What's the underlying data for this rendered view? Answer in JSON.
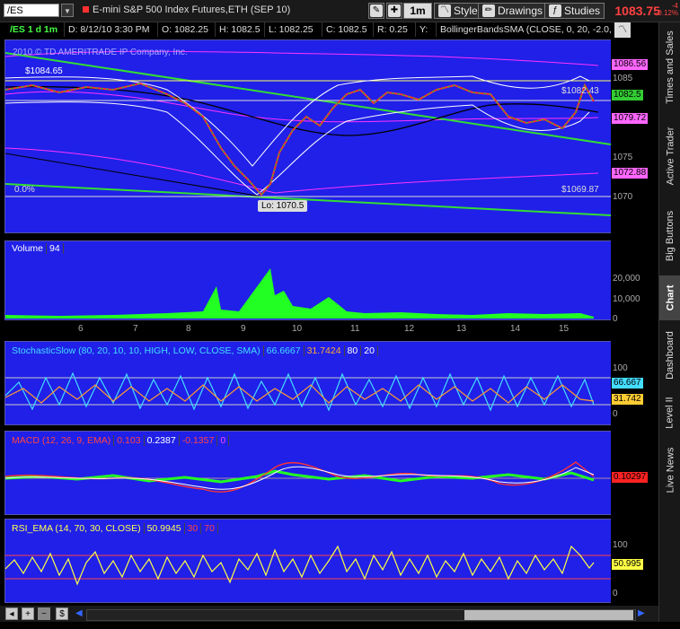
{
  "symbol": "/ES",
  "description": "E-mini S&P 500 Index Futures,ETH (SEP 10)",
  "toolbar": {
    "interval_label": "1m",
    "style_label": "Style",
    "drawings_label": "Drawings",
    "studies_label": "Studies",
    "last_price": "1083.75",
    "change_top": "-4",
    "change_bottom": "-0.12%"
  },
  "header": {
    "symbol_period": "/ES 1 d 1m",
    "date": "D: 8/12/10 3:30 PM",
    "open": "O: 1082.25",
    "high": "H: 1082.5",
    "low": "L: 1082.25",
    "close": "C: 1082.5",
    "range": "R: 0.25",
    "y": "Y:",
    "study": "BollingerBandsSMA (CLOSE, 0, 20, -2.0, ..."
  },
  "price_panel": {
    "copyright": "2010 © TD AMERITRADE IP Company, Inc.",
    "fib_top_label": "$1084.65",
    "fib_right_label": "$1082.43",
    "fib_bottom_pct": "0.0%",
    "fib_bottom_label": "$1069.87",
    "low_label": "Lo: 1070.5",
    "axis_ticks": [
      "1085",
      "1080",
      "1075",
      "1070"
    ],
    "tags": [
      {
        "text": "1086.56",
        "color": "#ff66ff",
        "fg": "#000"
      },
      {
        "text": "1082.5",
        "color": "#33cc33",
        "fg": "#000"
      },
      {
        "text": "1079.72",
        "color": "#ff66ff",
        "fg": "#000"
      },
      {
        "text": "1072.88",
        "color": "#ff66ff",
        "fg": "#000"
      }
    ]
  },
  "volume_panel": {
    "title": "Volume",
    "value": "94",
    "axis_ticks": [
      "20,000",
      "10,000",
      "0"
    ]
  },
  "x_axis": [
    "6",
    "7",
    "8",
    "9",
    "10",
    "11",
    "12",
    "13",
    "14",
    "15"
  ],
  "stoch_panel": {
    "title": "StochasticSlow (80, 20, 10, 10, HIGH, LOW, CLOSE, SMA)",
    "k": "66.6667",
    "d": "31.7424",
    "over_bought": "80",
    "over_sold": "20",
    "axis_ticks": [
      "100",
      "0"
    ],
    "tag_k": "66.667",
    "tag_d": "31.742"
  },
  "macd_panel": {
    "title": "MACD (12, 26, 9, EMA)",
    "value": "0.103",
    "avg": "0.2387",
    "diff": "-0.1357",
    "zero": "0",
    "tag": "0.10297"
  },
  "rsi_panel": {
    "title": "RSI_EMA (14, 70, 30, CLOSE)",
    "value": "50.9945",
    "over_sold": "30",
    "over_bought": "70",
    "axis_ticks": [
      "100",
      "0"
    ],
    "tag": "50.995"
  },
  "sidebar": {
    "tabs": [
      "Times and Sales",
      "Active Trader",
      "Big Buttons",
      "Chart",
      "Dashboard",
      "Level II",
      "Live News"
    ]
  },
  "colors": {
    "panel_bg": "#2020e8",
    "price_up": "#22cc22",
    "price_down": "#ff2222",
    "bollinger": "#ffffff",
    "trendline": "#33dd33",
    "fib": "#ffff66",
    "ma": "#000000",
    "envelope": "#ff33ff"
  }
}
